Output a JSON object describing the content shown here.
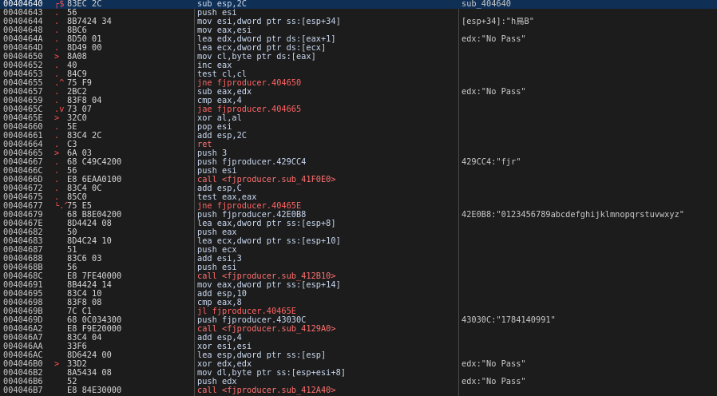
{
  "rows": [
    {
      "addr": "00404640",
      "gut": "┌$",
      "bytes": "83EC 2C",
      "instr": "sub esp,2C",
      "kind": "normal",
      "cmt": "sub_404640",
      "sel": true
    },
    {
      "addr": "00404643",
      "gut": ".",
      "bytes": "56",
      "instr": "push esi",
      "kind": "normal",
      "cmt": ""
    },
    {
      "addr": "00404644",
      "gut": ".",
      "bytes": "8B7424 34",
      "instr": "mov esi,dword ptr ss:[esp+34]",
      "kind": "normal",
      "cmt": "[esp+34]:\"h鳥B\""
    },
    {
      "addr": "00404648",
      "gut": ".",
      "bytes": "8BC6",
      "instr": "mov eax,esi",
      "kind": "normal",
      "cmt": ""
    },
    {
      "addr": "0040464A",
      "gut": ".",
      "bytes": "8D50 01",
      "instr": "lea edx,dword ptr ds:[eax+1]",
      "kind": "normal",
      "cmt": "edx:\"No Pass\""
    },
    {
      "addr": "0040464D",
      "gut": ".",
      "bytes": "8D49 00",
      "instr": "lea ecx,dword ptr ds:[ecx]",
      "kind": "normal",
      "cmt": ""
    },
    {
      "addr": "00404650",
      "gut": ">",
      "bytes": "8A08",
      "instr": "mov cl,byte ptr ds:[eax]",
      "kind": "normal",
      "cmt": ""
    },
    {
      "addr": "00404652",
      "gut": ".",
      "bytes": "40",
      "instr": "inc eax",
      "kind": "normal",
      "cmt": ""
    },
    {
      "addr": "00404653",
      "gut": ".",
      "bytes": "84C9",
      "instr": "test cl,cl",
      "kind": "normal",
      "cmt": ""
    },
    {
      "addr": "00404655",
      "gut": ".^",
      "bytes": "75 F9",
      "instr": "jne fjproducer.404650",
      "kind": "branch",
      "cmt": ""
    },
    {
      "addr": "00404657",
      "gut": ".",
      "bytes": "2BC2",
      "instr": "sub eax,edx",
      "kind": "normal",
      "cmt": "edx:\"No Pass\""
    },
    {
      "addr": "00404659",
      "gut": ".",
      "bytes": "83F8 04",
      "instr": "cmp eax,4",
      "kind": "normal",
      "cmt": ""
    },
    {
      "addr": "0040465C",
      "gut": ".v",
      "bytes": "73 07",
      "instr": "jae fjproducer.404665",
      "kind": "branch",
      "cmt": ""
    },
    {
      "addr": "0040465E",
      "gut": ">",
      "bytes": "32C0",
      "instr": "xor al,al",
      "kind": "normal",
      "cmt": ""
    },
    {
      "addr": "00404660",
      "gut": ".",
      "bytes": "5E",
      "instr": "pop esi",
      "kind": "normal",
      "cmt": ""
    },
    {
      "addr": "00404661",
      "gut": ".",
      "bytes": "83C4 2C",
      "instr": "add esp,2C",
      "kind": "normal",
      "cmt": ""
    },
    {
      "addr": "00404664",
      "gut": ".",
      "bytes": "C3",
      "instr": "ret",
      "kind": "ret",
      "cmt": ""
    },
    {
      "addr": "00404665",
      "gut": ">",
      "bytes": "6A 03",
      "instr": "push 3",
      "kind": "normal",
      "cmt": ""
    },
    {
      "addr": "00404667",
      "gut": ".",
      "bytes": "68 C49C4200",
      "instr": "push fjproducer.429CC4",
      "kind": "normal",
      "cmt": "429CC4:\"fjr\""
    },
    {
      "addr": "0040466C",
      "gut": ".",
      "bytes": "56",
      "instr": "push esi",
      "kind": "normal",
      "cmt": ""
    },
    {
      "addr": "0040466D",
      "gut": ".",
      "bytes": "E8 6EAA0100",
      "instr": "call <fjproducer.sub_41F0E0>",
      "kind": "call",
      "cmt": ""
    },
    {
      "addr": "00404672",
      "gut": ".",
      "bytes": "83C4 0C",
      "instr": "add esp,C",
      "kind": "normal",
      "cmt": ""
    },
    {
      "addr": "00404675",
      "gut": ".",
      "bytes": "85C0",
      "instr": "test eax,eax",
      "kind": "normal",
      "cmt": ""
    },
    {
      "addr": "00404677",
      "gut": "└.^",
      "bytes": "75 E5",
      "instr": "jne fjproducer.40465E",
      "kind": "branch",
      "cmt": ""
    },
    {
      "addr": "00404679",
      "gut": "",
      "bytes": "68 B8E04200",
      "instr": "push fjproducer.42E0B8",
      "kind": "normal",
      "cmt": "42E0B8:\"0123456789abcdefghijklmnopqrstuvwxyz\""
    },
    {
      "addr": "0040467E",
      "gut": "",
      "bytes": "8D4424 08",
      "instr": "lea eax,dword ptr ss:[esp+8]",
      "kind": "normal",
      "cmt": ""
    },
    {
      "addr": "00404682",
      "gut": "",
      "bytes": "50",
      "instr": "push eax",
      "kind": "normal",
      "cmt": ""
    },
    {
      "addr": "00404683",
      "gut": "",
      "bytes": "8D4C24 10",
      "instr": "lea ecx,dword ptr ss:[esp+10]",
      "kind": "normal",
      "cmt": ""
    },
    {
      "addr": "00404687",
      "gut": "",
      "bytes": "51",
      "instr": "push ecx",
      "kind": "normal",
      "cmt": ""
    },
    {
      "addr": "00404688",
      "gut": "",
      "bytes": "83C6 03",
      "instr": "add esi,3",
      "kind": "normal",
      "cmt": ""
    },
    {
      "addr": "0040468B",
      "gut": "",
      "bytes": "56",
      "instr": "push esi",
      "kind": "normal",
      "cmt": ""
    },
    {
      "addr": "0040468C",
      "gut": "",
      "bytes": "E8 7FE40000",
      "instr": "call <fjproducer.sub_412B10>",
      "kind": "call",
      "cmt": ""
    },
    {
      "addr": "00404691",
      "gut": "",
      "bytes": "8B4424 14",
      "instr": "mov eax,dword ptr ss:[esp+14]",
      "kind": "normal",
      "cmt": ""
    },
    {
      "addr": "00404695",
      "gut": "",
      "bytes": "83C4 10",
      "instr": "add esp,10",
      "kind": "normal",
      "cmt": ""
    },
    {
      "addr": "00404698",
      "gut": "",
      "bytes": "83F8 08",
      "instr": "cmp eax,8",
      "kind": "normal",
      "cmt": ""
    },
    {
      "addr": "0040469B",
      "gut": "",
      "bytes": "7C C1",
      "instr": "jl fjproducer.40465E",
      "kind": "branch",
      "cmt": ""
    },
    {
      "addr": "0040469D",
      "gut": "",
      "bytes": "68 0C034300",
      "instr": "push fjproducer.43030C",
      "kind": "normal",
      "cmt": "43030C:\"1784140991\""
    },
    {
      "addr": "004046A2",
      "gut": "",
      "bytes": "E8 F9E20000",
      "instr": "call <fjproducer.sub_4129A0>",
      "kind": "call",
      "cmt": ""
    },
    {
      "addr": "004046A7",
      "gut": "",
      "bytes": "83C4 04",
      "instr": "add esp,4",
      "kind": "normal",
      "cmt": ""
    },
    {
      "addr": "004046AA",
      "gut": "",
      "bytes": "33F6",
      "instr": "xor esi,esi",
      "kind": "normal",
      "cmt": ""
    },
    {
      "addr": "004046AC",
      "gut": "",
      "bytes": "8D6424 00",
      "instr": "lea esp,dword ptr ss:[esp]",
      "kind": "normal",
      "cmt": ""
    },
    {
      "addr": "004046B0",
      "gut": ">",
      "bytes": "33D2",
      "instr": "xor edx,edx",
      "kind": "normal",
      "cmt": "edx:\"No Pass\""
    },
    {
      "addr": "004046B2",
      "gut": "",
      "bytes": "8A5434 08",
      "instr": "mov dl,byte ptr ss:[esp+esi+8]",
      "kind": "normal",
      "cmt": ""
    },
    {
      "addr": "004046B6",
      "gut": "",
      "bytes": "52",
      "instr": "push edx",
      "kind": "normal",
      "cmt": "edx:\"No Pass\""
    },
    {
      "addr": "004046B7",
      "gut": "",
      "bytes": "E8 84E30000",
      "instr": "call <fjproducer.sub_412A40>",
      "kind": "call",
      "cmt": ""
    }
  ]
}
